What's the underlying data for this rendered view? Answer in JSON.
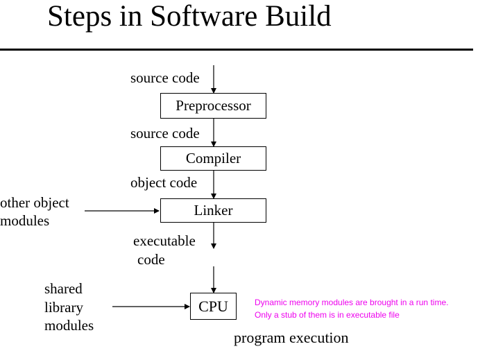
{
  "title": "Steps in Software Build",
  "labels": {
    "source_code_1": "source code",
    "source_code_2": "source code",
    "object_code": "object code",
    "executable_code_line1": "executable",
    "executable_code_line2": "code",
    "other_object_line1": "other object",
    "other_object_line2": "modules",
    "shared_line1": "shared",
    "shared_line2": "library",
    "shared_line3": "modules",
    "program_execution": "program execution"
  },
  "boxes": {
    "preprocessor": "Preprocessor",
    "compiler": "Compiler",
    "linker": "Linker",
    "cpu": "CPU"
  },
  "note": {
    "line1": "Dynamic memory modules are brought in a run time.",
    "line2": "Only a stub of them is in executable file",
    "color": "#ee00ee"
  }
}
